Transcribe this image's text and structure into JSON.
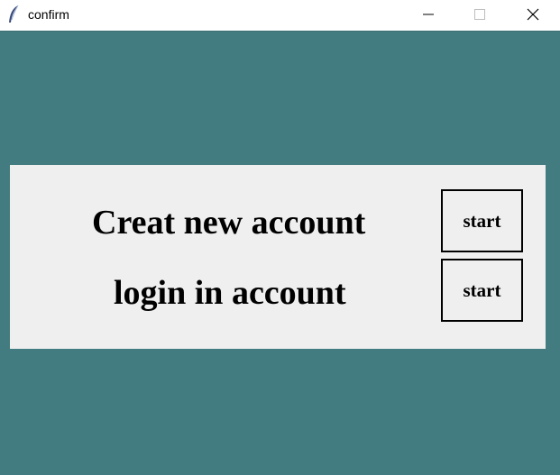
{
  "window": {
    "title": "confirm",
    "app_icon": "tk-feather-icon",
    "controls": [
      "minimize-icon",
      "maximize-icon",
      "close-icon"
    ]
  },
  "colors": {
    "background": "#437c80",
    "panel": "#efefef",
    "text": "#000000"
  },
  "rows": [
    {
      "label": "Creat new account",
      "button_label": "start"
    },
    {
      "label": "login in account",
      "button_label": "start"
    }
  ]
}
